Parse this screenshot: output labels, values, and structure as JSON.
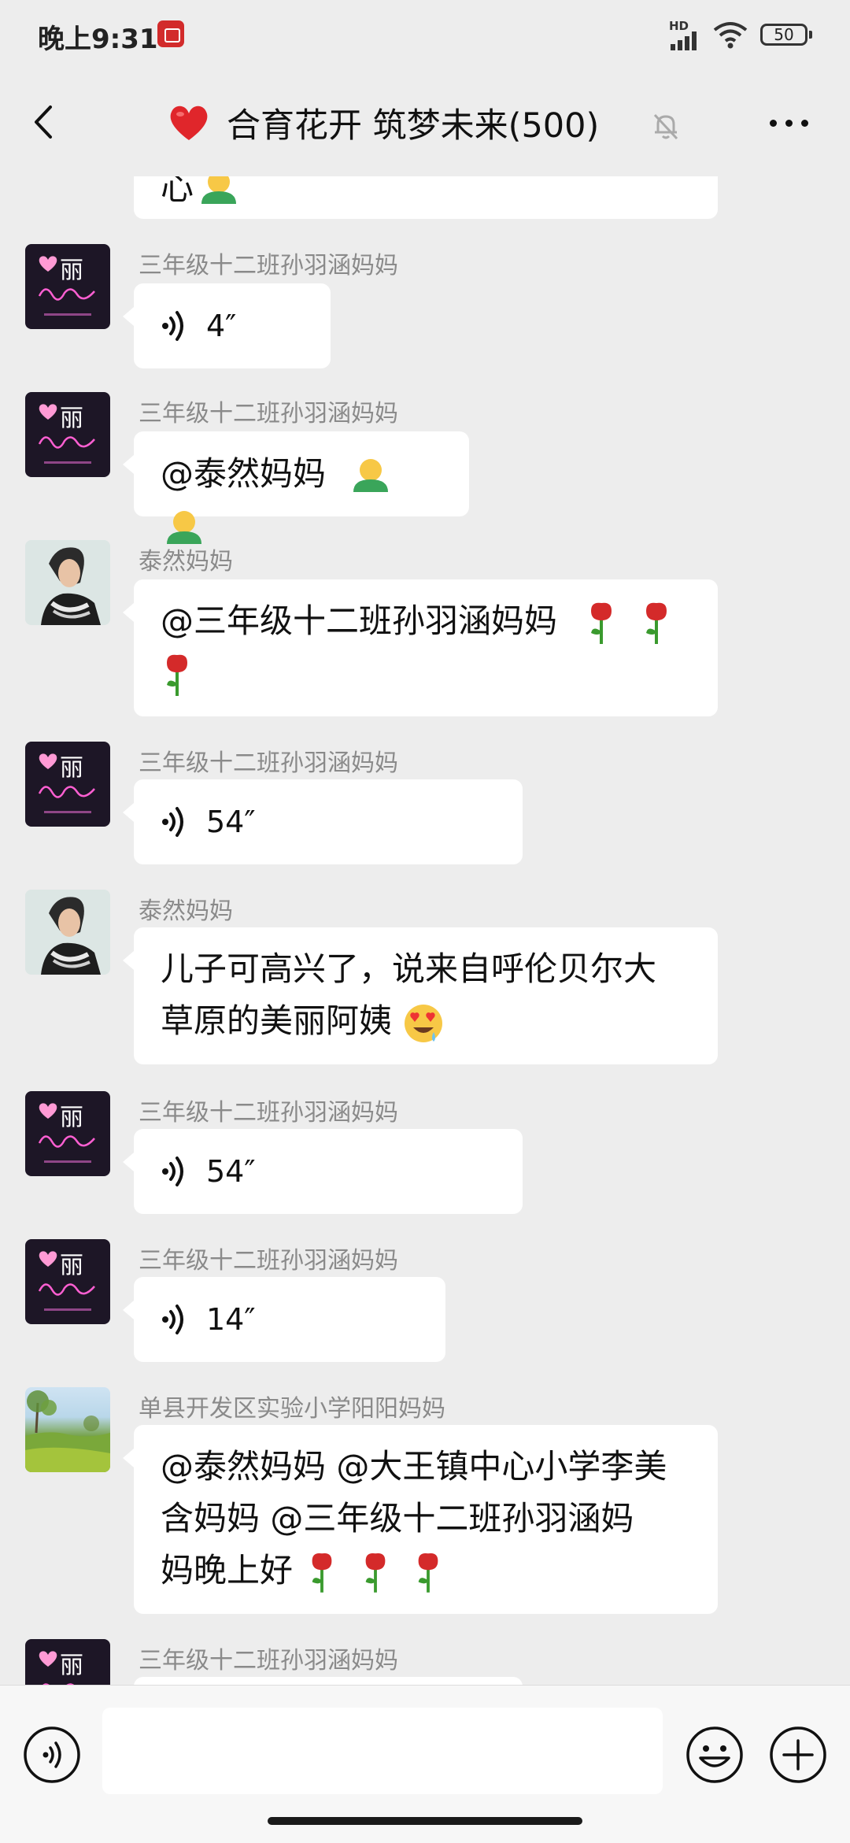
{
  "status": {
    "time": "晚上9:31",
    "network": "HD",
    "battery": "50"
  },
  "nav": {
    "title": "合育花开 筑梦未来(500)"
  },
  "messages": [
    {
      "sender": "",
      "text": "心"
    },
    {
      "sender": "三年级十二班孙羽涵妈妈",
      "voice": "4″"
    },
    {
      "sender": "三年级十二班孙羽涵妈妈",
      "text": "@泰然妈妈"
    },
    {
      "sender": "泰然妈妈",
      "text": "@三年级十二班孙羽涵妈妈"
    },
    {
      "sender": "三年级十二班孙羽涵妈妈",
      "voice": "54″"
    },
    {
      "sender": "泰然妈妈",
      "text_line1": "儿子可高兴了，说来自呼伦贝尔大",
      "text_line2": "草原的美丽阿姨"
    },
    {
      "sender": "三年级十二班孙羽涵妈妈",
      "voice": "54″"
    },
    {
      "sender": "三年级十二班孙羽涵妈妈",
      "voice": "14″"
    },
    {
      "sender": "单县开发区实验小学阳阳妈妈",
      "text_line1": "@泰然妈妈 @大王镇中心小学李美",
      "text_line2": "含妈妈 @三年级十二班孙羽涵妈",
      "text_line3": "妈晚上好"
    },
    {
      "sender": "三年级十二班孙羽涵妈妈"
    }
  ],
  "avatars": {
    "li_label": "丽"
  },
  "input": {
    "value": ""
  },
  "colors": {
    "background": "#ededed",
    "bubble": "#ffffff",
    "sender": "#8a8a8a",
    "rose": "#d42a2a",
    "stem": "#3a9a2e"
  },
  "icons": [
    "back-icon",
    "heart-icon",
    "mute-bell-icon",
    "more-icon",
    "voice-icon",
    "hug-emoji",
    "rose-emoji",
    "heart-eyes-emoji",
    "voice-input-icon",
    "emoji-icon",
    "plus-icon",
    "signal-icon",
    "wifi-icon",
    "battery-icon"
  ]
}
